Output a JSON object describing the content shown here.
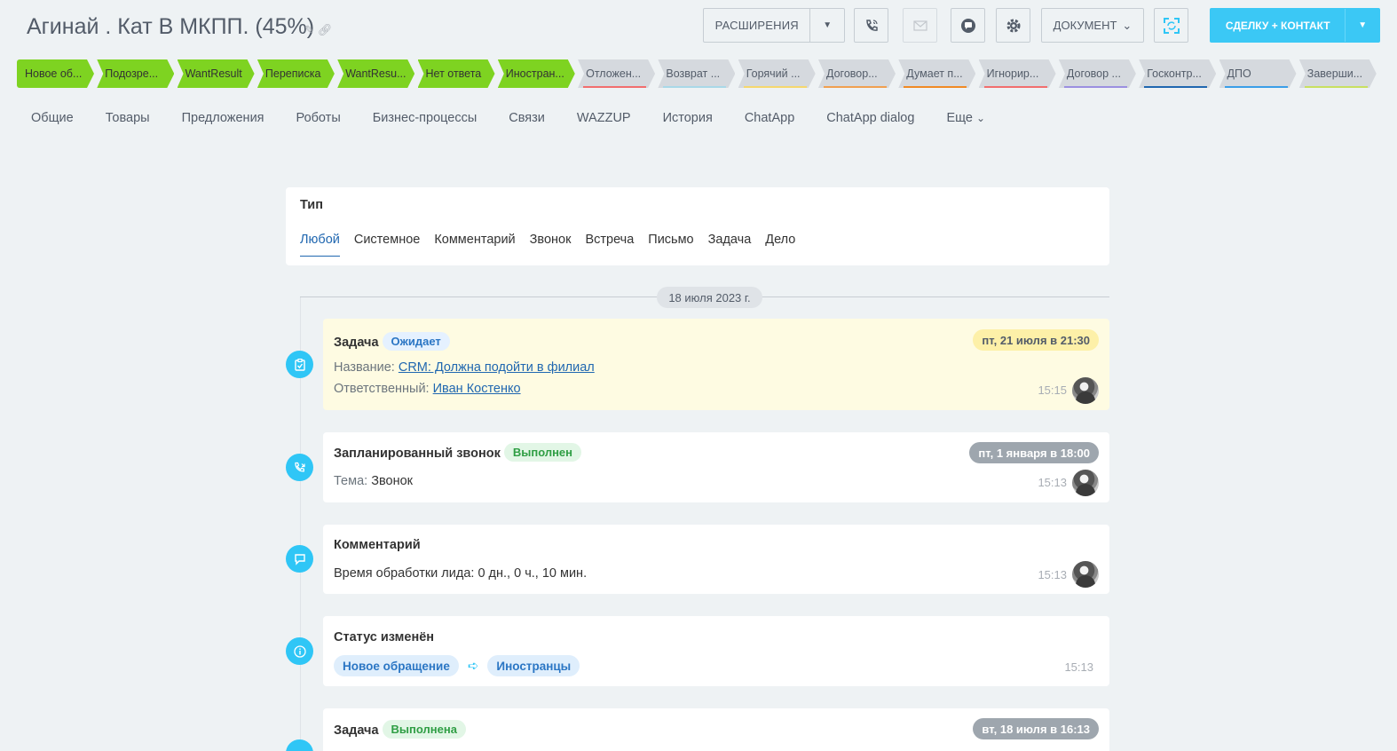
{
  "header": {
    "title": "Агинай . Кат В МКПП. (45%)",
    "extensions_label": "РАСШИРЕНИЯ",
    "document_label": "ДОКУМЕНТ",
    "deal_contact_label": "СДЕЛКУ + КОНТАКТ",
    "icons": [
      "edit-icon",
      "link-icon",
      "phone-icon",
      "mail-icon",
      "chat-icon",
      "gear-icon",
      "scan-icon"
    ]
  },
  "stages": [
    {
      "label": "Новое об...",
      "state": "done"
    },
    {
      "label": "Подозре...",
      "state": "done"
    },
    {
      "label": "WantResult",
      "state": "done"
    },
    {
      "label": "Переписка",
      "state": "done"
    },
    {
      "label": "WantResu...",
      "state": "done"
    },
    {
      "label": "Нет ответа",
      "state": "done"
    },
    {
      "label": "Иностран...",
      "state": "done"
    },
    {
      "label": "Отложен...",
      "state": "todo",
      "color": "#f26e6e"
    },
    {
      "label": "Возврат ...",
      "state": "todo",
      "color": "#a9d8e8"
    },
    {
      "label": "Горячий ...",
      "state": "todo",
      "color": "#f5d76e"
    },
    {
      "label": "Договор...",
      "state": "todo",
      "color": "#f0a050"
    },
    {
      "label": "Думает п...",
      "state": "todo",
      "color": "#f08a24"
    },
    {
      "label": "Игнорир...",
      "state": "todo",
      "color": "#f26e6e"
    },
    {
      "label": "Договор ...",
      "state": "todo",
      "color": "#9b8fe0"
    },
    {
      "label": "Госконтр...",
      "state": "todo",
      "color": "#2067b0"
    },
    {
      "label": "ДПО",
      "state": "todo",
      "color": "#3a9ee8"
    },
    {
      "label": "Заверши...",
      "state": "todo",
      "color": "#c8e060"
    }
  ],
  "tabs": [
    "Общие",
    "Товары",
    "Предложения",
    "Роботы",
    "Бизнес-процессы",
    "Связи",
    "WAZZUP",
    "История",
    "ChatApp",
    "ChatApp dialog",
    "Еще"
  ],
  "filter": {
    "title": "Тип",
    "tabs": [
      "Любой",
      "Системное",
      "Комментарий",
      "Звонок",
      "Встреча",
      "Письмо",
      "Задача",
      "Дело"
    ],
    "active": "Любой"
  },
  "timeline": {
    "date": "18 июля 2023 г.",
    "items": {
      "task1": {
        "title": "Задача",
        "badge": "Ожидает",
        "deadline": "пт, 21 июля в 21:30",
        "name_label": "Название:",
        "name_value": "CRM: Должна подойти в филиал",
        "resp_label": "Ответственный:",
        "resp_value": "Иван Костенко",
        "time": "15:15"
      },
      "call": {
        "title": "Запланированный звонок",
        "badge": "Выполнен",
        "deadline": "пт, 1 января в 18:00",
        "topic_label": "Тема:",
        "topic_value": "Звонок",
        "time": "15:13"
      },
      "comment": {
        "title": "Комментарий",
        "text": "Время обработки лида: 0 дн., 0 ч., 10 мин.",
        "time": "15:13"
      },
      "status": {
        "title": "Статус изменён",
        "from": "Новое обращение",
        "to": "Иностранцы",
        "time": "15:13"
      },
      "task2": {
        "title": "Задача",
        "badge": "Выполнена",
        "deadline": "вт, 18 июля в 16:13"
      }
    }
  }
}
